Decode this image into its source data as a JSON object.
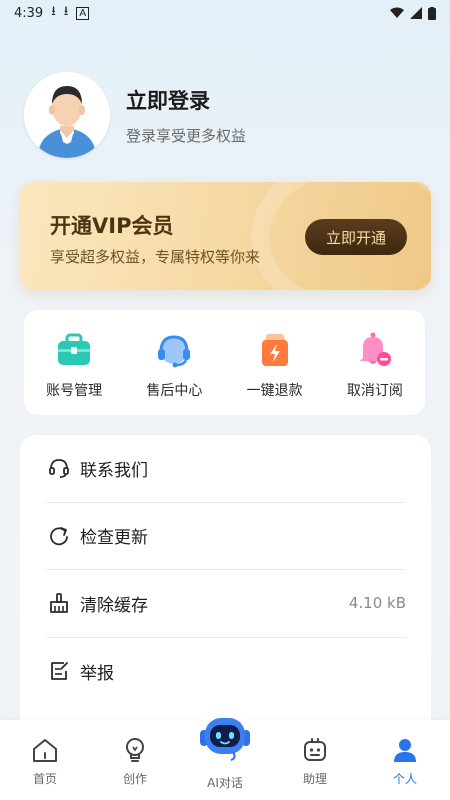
{
  "status_bar": {
    "time": "4:39",
    "download_glyph": "⭳",
    "a_badge": "A",
    "battery_glyph": "▮"
  },
  "profile": {
    "title": "立即登录",
    "subtitle": "登录享受更多权益"
  },
  "vip": {
    "title": "开通VIP会员",
    "subtitle": "享受超多权益，专属特权等你来",
    "button_label": "立即开通"
  },
  "quick_actions": [
    {
      "label": "账号管理",
      "icon": "briefcase-icon",
      "color": "#2cc8b3"
    },
    {
      "label": "售后中心",
      "icon": "headset-icon",
      "color": "#3a8cf0"
    },
    {
      "label": "一键退款",
      "icon": "refund-bag-icon",
      "color": "#ff7a3c"
    },
    {
      "label": "取消订阅",
      "icon": "bell-off-icon",
      "color": "#ff6fb0"
    }
  ],
  "menu": [
    {
      "label": "联系我们",
      "icon": "headset-line-icon",
      "value": ""
    },
    {
      "label": "检查更新",
      "icon": "refresh-icon",
      "value": ""
    },
    {
      "label": "清除缓存",
      "icon": "broom-icon",
      "value": "4.10 kB"
    },
    {
      "label": "举报",
      "icon": "report-icon",
      "value": ""
    }
  ],
  "tabs": [
    {
      "label": "首页",
      "icon": "home-icon"
    },
    {
      "label": "创作",
      "icon": "bulb-icon"
    },
    {
      "label": "AI对话",
      "icon": "robot-icon"
    },
    {
      "label": "助理",
      "icon": "assistant-icon"
    },
    {
      "label": "个人",
      "icon": "person-icon",
      "active": true
    }
  ],
  "colors": {
    "accent": "#2a73ea",
    "vip_gold": "#f0c987",
    "vip_button": "#4a3214"
  }
}
